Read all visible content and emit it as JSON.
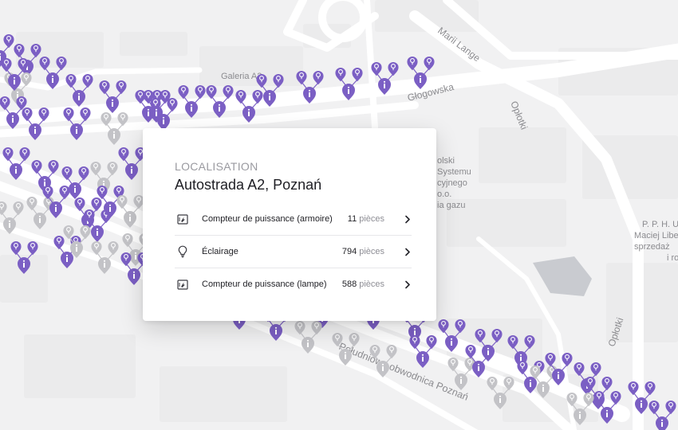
{
  "map": {
    "street_labels": [
      {
        "text": "Galeria A2"
      },
      {
        "text": "Głogowska"
      },
      {
        "text": "Marii Lange"
      },
      {
        "text": "Opłotki"
      },
      {
        "text": "Opłotki"
      },
      {
        "text": "Południowa obwodnica Poznań"
      },
      {
        "text": "olski"
      },
      {
        "text": "Systemu"
      },
      {
        "text": "cyjnego"
      },
      {
        "text": "o.o."
      },
      {
        "text": "ia gazu"
      },
      {
        "text": "P. P. H. U"
      },
      {
        "text": "Maciej Libe"
      },
      {
        "text": "sprzedaż"
      },
      {
        "text": "i ro"
      }
    ],
    "colors": {
      "background": "#f1f1f2",
      "road": "#ffffff",
      "block": "#e5e5e7",
      "water": "#c9cbd0",
      "marker_active": "#7b5fc4",
      "marker_inactive": "#c3c3c7"
    }
  },
  "card": {
    "eyebrow": "LOCALISATION",
    "title": "Autostrada A2, Poznań",
    "rows": [
      {
        "icon": "meter-icon",
        "label": "Compteur de puissance (armoire)",
        "count": "11",
        "unit": "pièces"
      },
      {
        "icon": "bulb-icon",
        "label": "Éclairage",
        "count": "794",
        "unit": "pièces"
      },
      {
        "icon": "meter-icon",
        "label": "Compteur de puissance (lampe)",
        "count": "588",
        "unit": "pièces"
      }
    ]
  }
}
